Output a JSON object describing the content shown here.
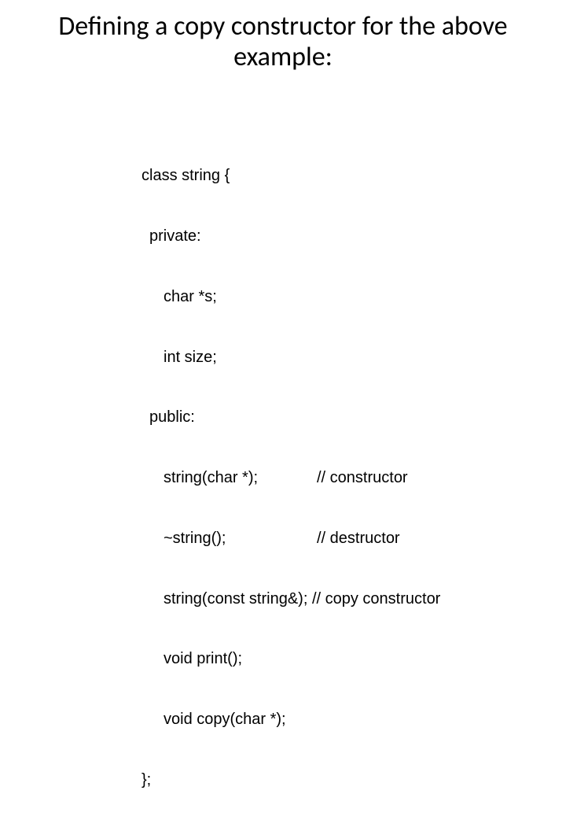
{
  "title": "Defining a copy constructor for the above example:",
  "code": {
    "l1": "class string {",
    "l2": "private:",
    "l3": "char *s;",
    "l4": "int size;",
    "l5": "public:",
    "l6a": "string(char *);",
    "l6b": "// constructor",
    "l7a": "~string();",
    "l7b": "// destructor",
    "l8a": "string(const string&);",
    "l8b": " // copy constructor",
    "l9": "void print();",
    "l10": "void copy(char *);",
    "l11": "};"
  }
}
